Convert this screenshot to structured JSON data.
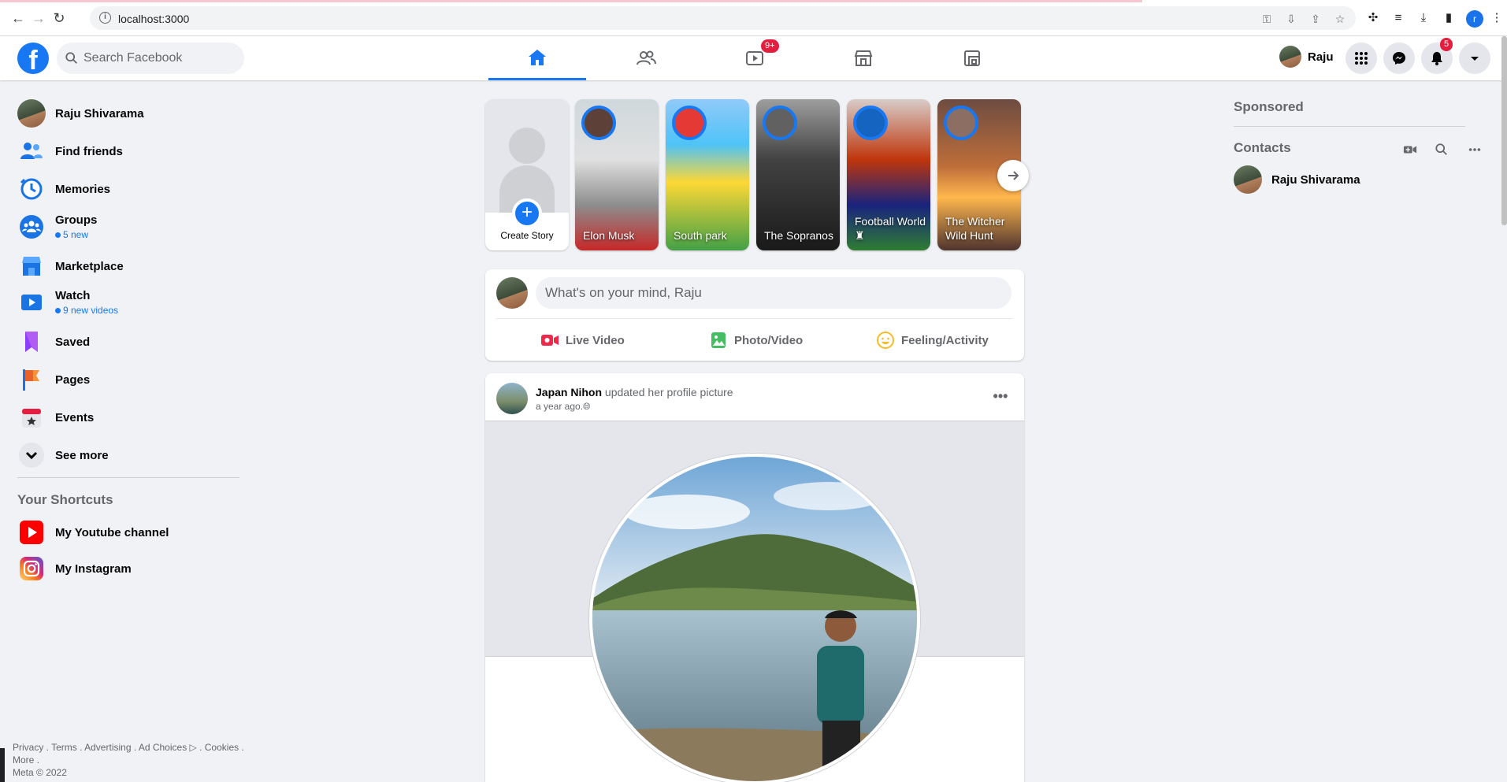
{
  "browser": {
    "url": "localhost:3000",
    "profile_initial": "r"
  },
  "header": {
    "logo": "f",
    "search_placeholder": "Search Facebook",
    "watch_badge": "9+",
    "user_name": "Raju",
    "notifications_badge": "5"
  },
  "sidebar": {
    "items": [
      {
        "label": "Raju Shivarama"
      },
      {
        "label": "Find friends"
      },
      {
        "label": "Memories"
      },
      {
        "label": "Groups",
        "sub": "5 new"
      },
      {
        "label": "Marketplace"
      },
      {
        "label": "Watch",
        "sub": "9 new videos"
      },
      {
        "label": "Saved"
      },
      {
        "label": "Pages"
      },
      {
        "label": "Events"
      },
      {
        "label": "See more"
      }
    ],
    "shortcuts_title": "Your Shortcuts",
    "shortcuts": [
      {
        "label": "My Youtube channel"
      },
      {
        "label": "My Instagram"
      }
    ],
    "footer_line1": "Privacy . Terms . Advertising . Ad Choices ▷ . Cookies .",
    "footer_line2": "More .",
    "footer_line3": "Meta © 2022"
  },
  "stories": {
    "create_label": "Create Story",
    "items": [
      {
        "label": "Elon Musk"
      },
      {
        "label": "South park"
      },
      {
        "label": "The Sopranos"
      },
      {
        "label": "Football World ♜"
      },
      {
        "label": "The Witcher Wild Hunt"
      }
    ]
  },
  "composer": {
    "placeholder": "What's on your mind, Raju",
    "live_video": "Live Video",
    "photo_video": "Photo/Video",
    "feeling": "Feeling/Activity"
  },
  "post": {
    "author": "Japan Nihon",
    "action": "updated her profile picture",
    "time": "a year ago.",
    "more": "•••"
  },
  "right": {
    "sponsored": "Sponsored",
    "contacts": "Contacts",
    "contact_name": "Raju Shivarama"
  },
  "colors": {
    "brand": "#1877f2",
    "badge": "#e41e3f",
    "background": "#f0f2f5"
  }
}
